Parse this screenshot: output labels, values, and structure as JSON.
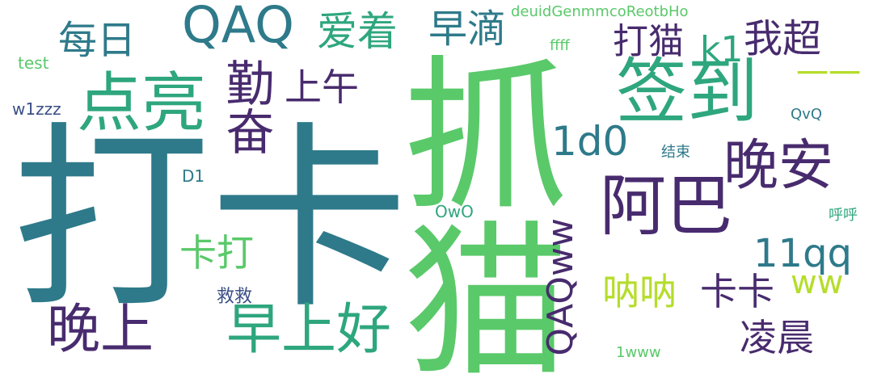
{
  "words": {
    "daka": "打卡",
    "zhuamao": "抓猫",
    "qiandao": "签到",
    "dianliang": "点亮",
    "afu": "阿巴",
    "wanan": "晚安",
    "zaoshanghao": "早上好",
    "wanshang": "晚上",
    "qaq": "QAQ",
    "meiri": "每日",
    "aizhe": "爱着",
    "zaodi": "早滴",
    "damao": "打猫",
    "k1": "k1",
    "wochao": "我超",
    "shangwu": "上午",
    "yiyi": "一一",
    "oneD0": "1d0",
    "elevenqq": "11qq",
    "kada": "卡打",
    "nana": "呐呐",
    "kaka": "卡卡",
    "ww": "ww",
    "lingchen": "凌晨",
    "qaqww": "QAQww",
    "qiangwen": "勤奋",
    "jiejiu": "救救",
    "jieshu": "结束",
    "owo": "OwO",
    "qvq": "QvQ",
    "huhu": "呼呼",
    "d1": "D1",
    "w1zzz": "w1zzz",
    "test": "test",
    "ffff": "ffff",
    "deuid": "deuidGenmmcoReotbHo",
    "onewww": "1www"
  }
}
